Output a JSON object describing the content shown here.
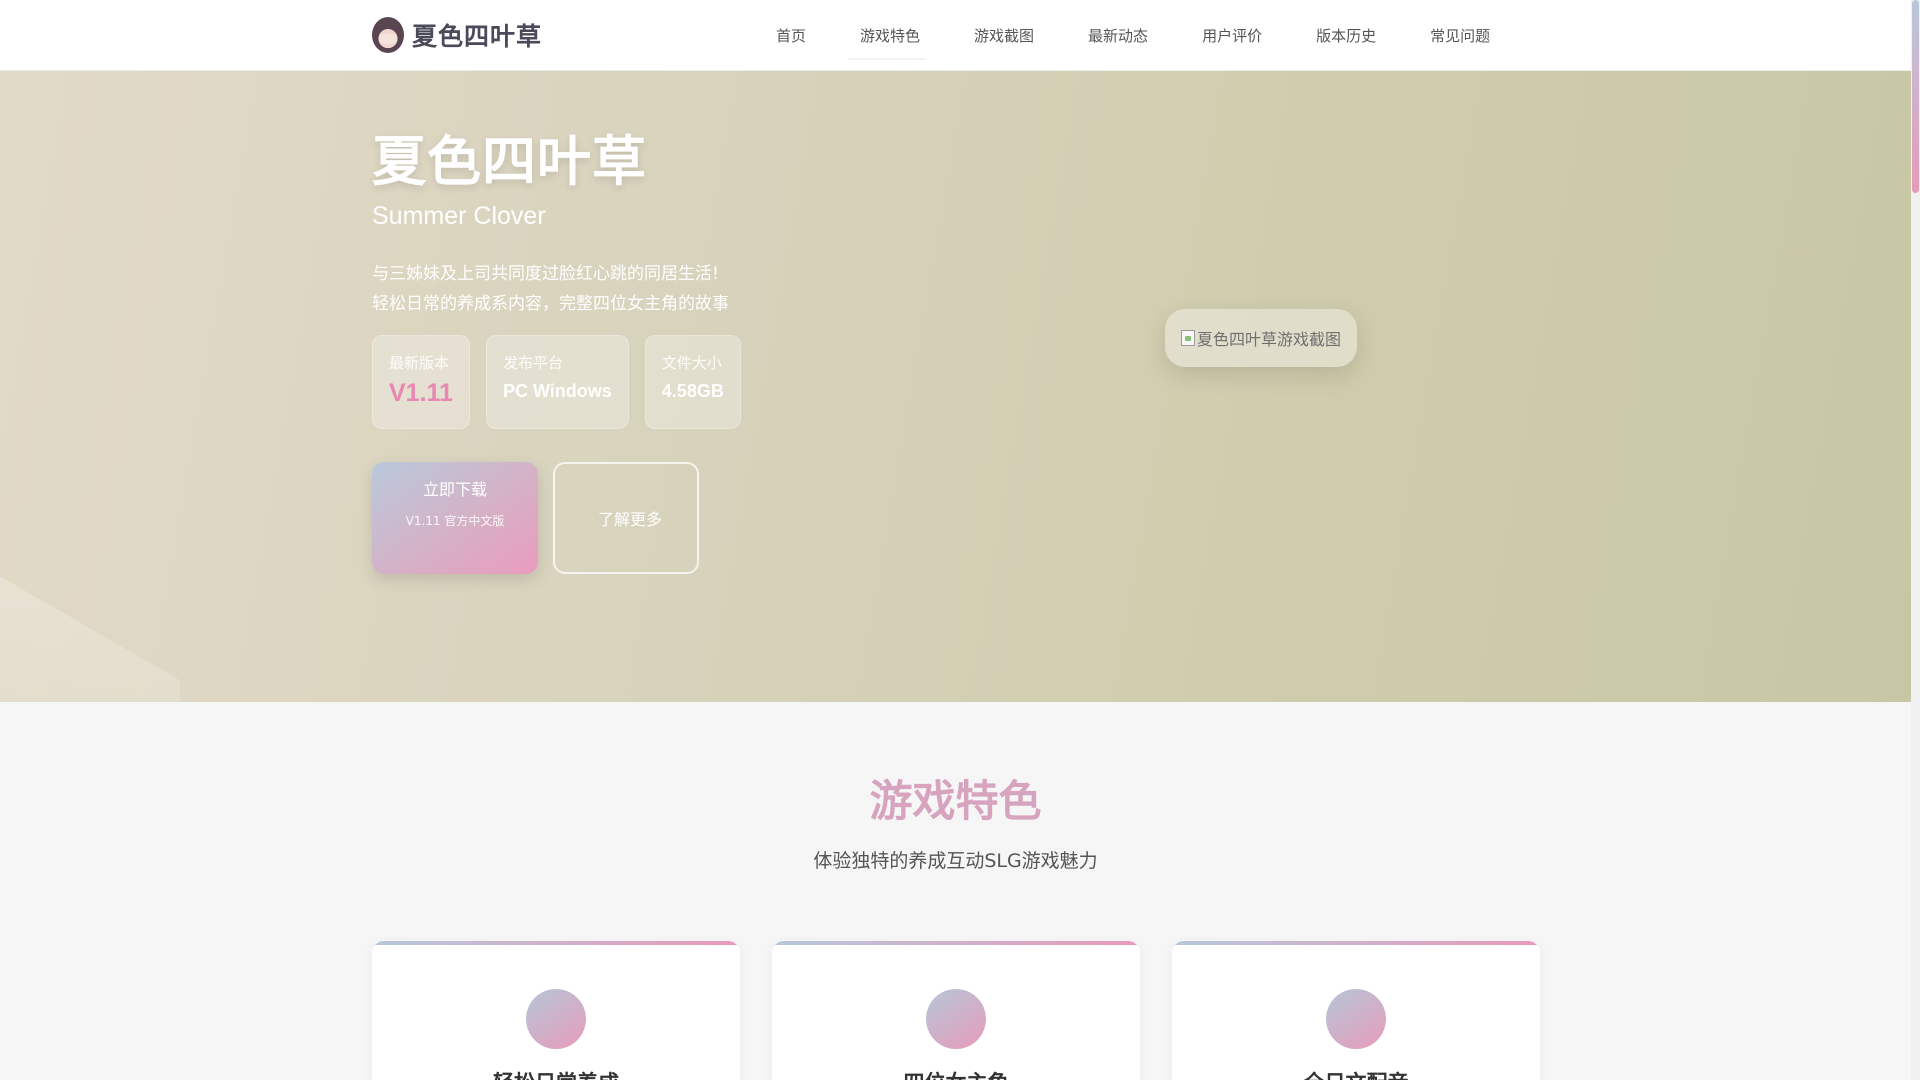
{
  "header": {
    "logo_text": "夏色四叶草",
    "nav": [
      {
        "icon": "",
        "label": "首页"
      },
      {
        "icon": "",
        "label": "游戏特色"
      },
      {
        "icon": "",
        "label": "游戏截图"
      },
      {
        "icon": "",
        "label": "最新动态"
      },
      {
        "icon": "",
        "label": "用户评价"
      },
      {
        "icon": "",
        "label": "版本历史"
      },
      {
        "icon": "",
        "label": "常见问题"
      }
    ]
  },
  "hero": {
    "title": "夏色四叶草",
    "subtitle": "Summer Clover",
    "desc_line1": "与三姊妹及上司共同度过脸红心跳的同居生活!",
    "desc_line2": "轻松日常的养成系内容，完整四位女主角的故事",
    "stats": [
      {
        "label": "最新版本",
        "value": "V1.11"
      },
      {
        "label": "发布平台",
        "value": "PC Windows"
      },
      {
        "label": "文件大小",
        "value": "4.58GB"
      }
    ],
    "download": {
      "icon": "",
      "label": "立即下载",
      "sub": "V1.11 官方中文版"
    },
    "more": {
      "icon": "",
      "label": "了解更多"
    },
    "screenshot_alt": "夏色四叶草游戏截图"
  },
  "features": {
    "title": "游戏特色",
    "subtitle": "体验独特的养成互动SLG游戏魅力",
    "cards": [
      {
        "icon": "",
        "title": "轻松日常养成"
      },
      {
        "icon": "",
        "title": "四位女主角"
      },
      {
        "icon": "",
        "title": "全日文配音"
      }
    ]
  },
  "colors": {
    "accent_pink": "#e987b3",
    "accent_blue": "#b9c9dc",
    "title_pink": "#d7a4bf"
  }
}
